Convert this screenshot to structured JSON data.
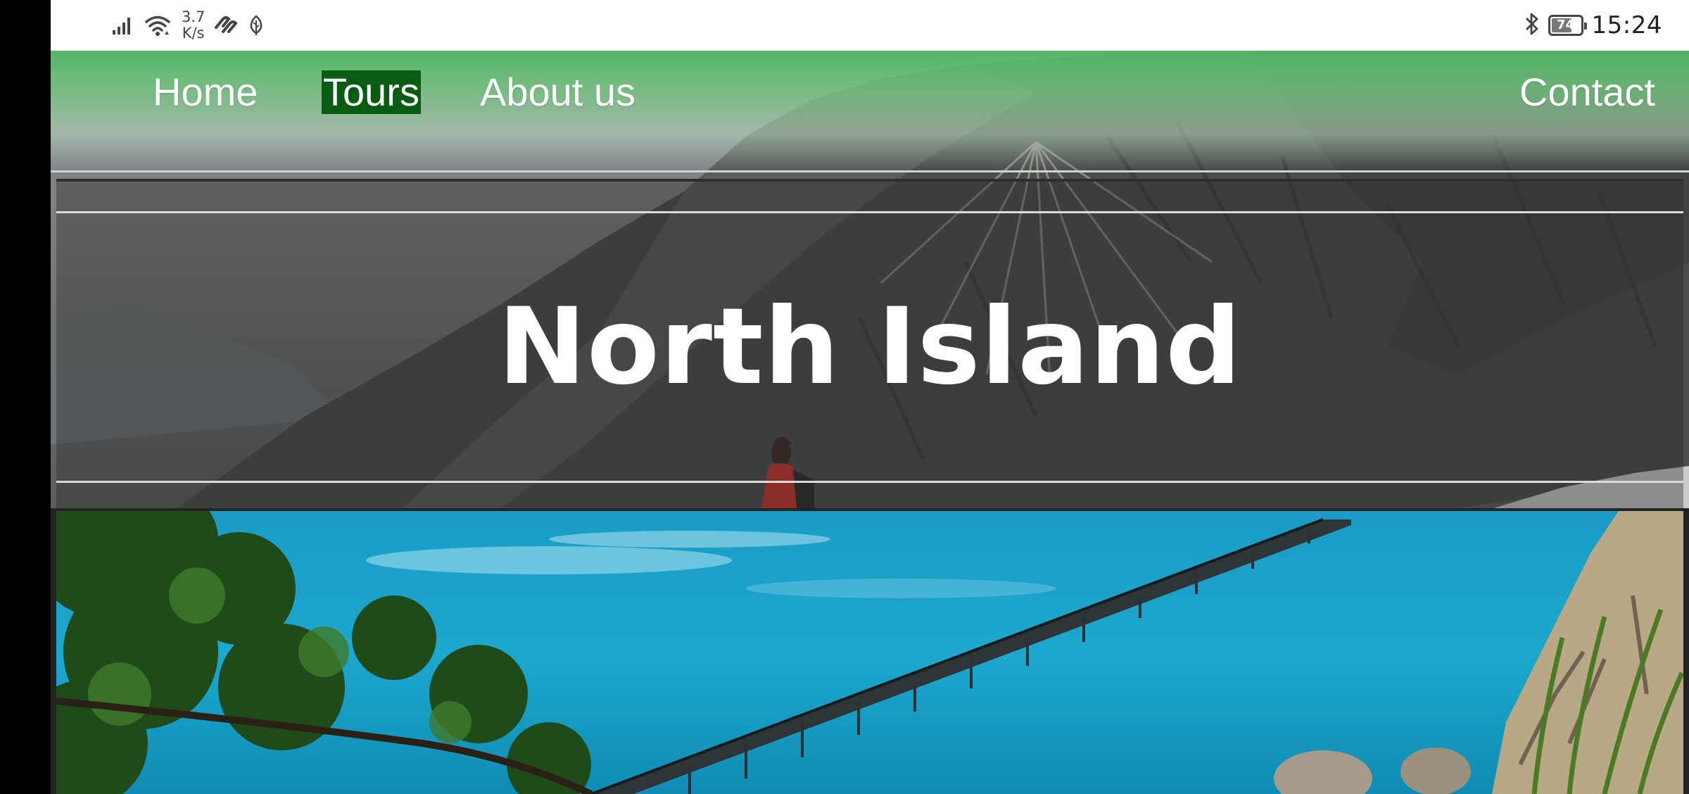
{
  "status_bar": {
    "net_speed_value": "3.7",
    "net_speed_unit": "K/s",
    "battery_level": "74",
    "time": "15:24",
    "icons": [
      "signal-icon",
      "wifi-icon",
      "pay-icon",
      "leaf-icon",
      "bluetooth-icon",
      "battery-icon"
    ]
  },
  "nav": {
    "items": [
      {
        "label": "Home"
      },
      {
        "label": "Tours"
      },
      {
        "label": "About us"
      },
      {
        "label": "Contact"
      }
    ],
    "active": "Tours",
    "colors": {
      "bar": "#52b866",
      "active_highlight": "#0a5c12",
      "text": "#ffffff"
    }
  },
  "hero": {
    "title": "North Island"
  },
  "colors": {
    "sea": "#1da8cd",
    "text_primary": "#ffffff"
  }
}
